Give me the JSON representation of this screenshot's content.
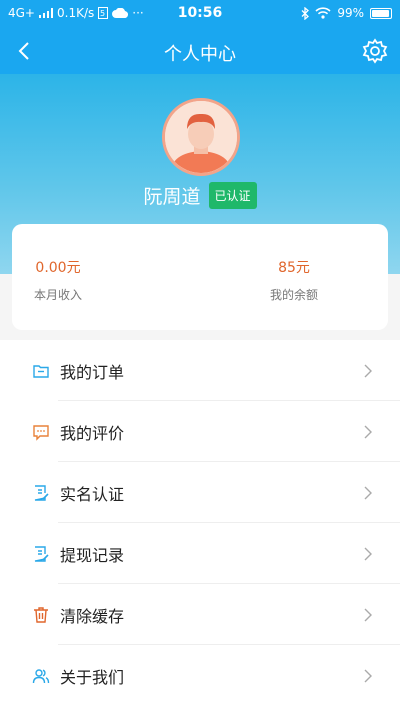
{
  "status_bar": {
    "network": "4G+",
    "speed": "0.1K/s",
    "time": "10:56",
    "battery": "99%",
    "dots": "···"
  },
  "nav": {
    "title": "个人中心"
  },
  "profile": {
    "name": "阮周道",
    "badge": "已认证"
  },
  "stats": [
    {
      "value": "0.00元",
      "label": "本月收入"
    },
    {
      "value": "85元",
      "label": "我的余额"
    }
  ],
  "menu": [
    {
      "label": "我的订单",
      "icon": "folder-icon",
      "icon_color": "#2aa8e8"
    },
    {
      "label": "我的评价",
      "icon": "comment-icon",
      "icon_color": "#e8823a"
    },
    {
      "label": "实名认证",
      "icon": "document-edit-icon",
      "icon_color": "#2aa8e8"
    },
    {
      "label": "提现记录",
      "icon": "document-edit-icon",
      "icon_color": "#2aa8e8"
    },
    {
      "label": "清除缓存",
      "icon": "trash-icon",
      "icon_color": "#e0662c"
    },
    {
      "label": "关于我们",
      "icon": "users-icon",
      "icon_color": "#2aa8e8"
    }
  ],
  "colors": {
    "header": "#1aa7f0",
    "accent_value": "#e0662c",
    "verified_green": "#1fb86a"
  }
}
